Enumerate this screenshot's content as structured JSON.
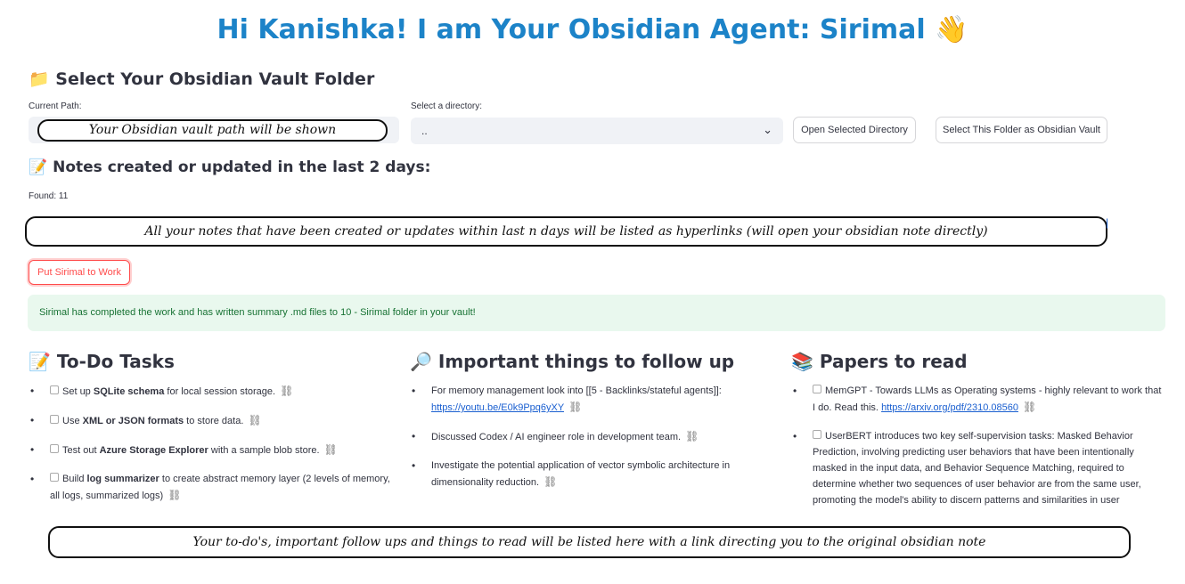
{
  "header": {
    "title": "Hi Kanishka! I am Your Obsidian Agent: Sirimal",
    "wave_icon": "👋"
  },
  "vault": {
    "folder_icon": "📁",
    "heading": "Select Your Obsidian Vault Folder",
    "current_path_label": "Current Path:",
    "path_annotation": "Your Obsidian vault path will be shown",
    "select_label": "Select a directory:",
    "select_value": "..",
    "open_button": "Open Selected Directory",
    "select_folder_button": "Select This Folder as Obsidian Vault"
  },
  "recent": {
    "icon": "📝",
    "heading": "Notes created or updated in the last 2 days:",
    "found": "Found: 11",
    "annotation": "All your notes that have been created or updates within last n days will be listed as hyperlinks (will open your obsidian note directly)"
  },
  "run_button": "Put Sirimal to Work",
  "success_message": "Sirimal has completed the work and has written summary .md files to 10 - Sirimal folder in your vault!",
  "todo": {
    "icon": "📝",
    "heading": "To-Do Tasks",
    "items": [
      {
        "pre": "Set up ",
        "bold": "SQLite schema",
        "post": " for local session storage."
      },
      {
        "pre": "Use ",
        "bold": "XML or JSON formats",
        "post": " to store data."
      },
      {
        "pre": "Test out ",
        "bold": "Azure Storage Explorer",
        "post": " with a sample blob store."
      },
      {
        "pre": "Build ",
        "bold": "log summarizer",
        "post": " to create abstract memory layer (2 levels of memory, all logs, summarized logs)"
      }
    ]
  },
  "followup": {
    "icon": "🔎",
    "heading": "Important things to follow up",
    "items": [
      {
        "text": "For memory management look into [[5 - Backlinks/stateful agents]]:",
        "link": "https://youtu.be/E0k9Ppq6yXY"
      },
      {
        "text": "Discussed Codex / AI engineer role in development team.",
        "link": ""
      },
      {
        "text": "Investigate the potential application of vector symbolic architecture in dimensionality reduction.",
        "link": ""
      }
    ]
  },
  "papers": {
    "icon": "📚",
    "heading": "Papers to read",
    "items": [
      {
        "text": "MemGPT - Towards LLMs as Operating systems - highly relevant to work that I do. Read this.",
        "link": "https://arxiv.org/pdf/2310.08560"
      },
      {
        "text": "UserBERT introduces two key self-supervision tasks: Masked Behavior Prediction, involving predicting user behaviors that have been intentionally masked in the input data, and Behavior Sequence Matching, required to determine whether two sequences of user behavior are from the same user, promoting the model's ability to discern patterns and similarities in user",
        "link": ""
      }
    ]
  },
  "bottom_annotation": "Your to-do's, important follow ups and things to read will be listed here with a link directing you to the original obsidian note",
  "link_icon": "🔗",
  "chain_glyph": "⛓"
}
